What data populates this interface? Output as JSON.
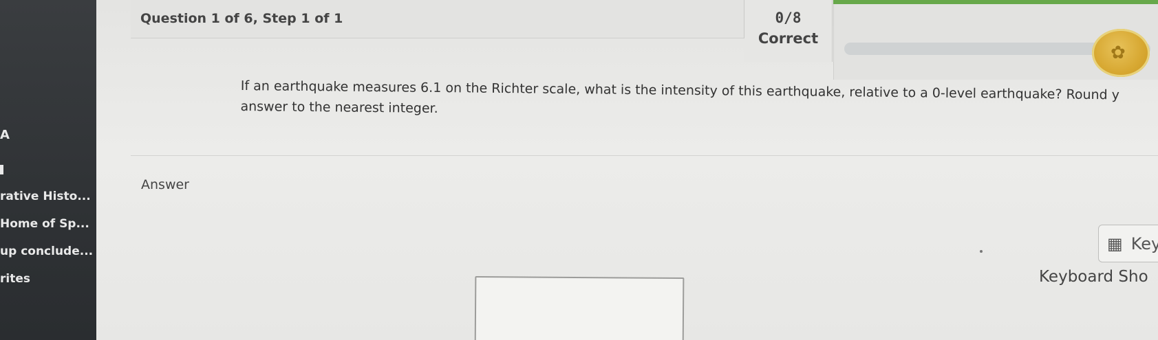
{
  "sidebar": {
    "items": [
      {
        "label": "A"
      },
      {
        "label": "rative Histo..."
      },
      {
        "label": "Home of Sp..."
      },
      {
        "label": "up conclude..."
      },
      {
        "label": "rites"
      }
    ]
  },
  "header": {
    "question_title": "Question 1 of 6, Step 1 of 1",
    "score": "0/8",
    "score_caption": "Correct",
    "progress_fraction": 0
  },
  "question": {
    "text": "If an earthquake measures 6.1 on the Richter scale, what is the intensity of this earthquake, relative to a 0-level earthquake? Round y answer to the nearest integer."
  },
  "answer": {
    "label": "Answer",
    "value": ""
  },
  "tools": {
    "keypad_label": "Key",
    "keypad_icon": "calculator-icon",
    "shortcuts_label": "Keyboard Sho"
  },
  "colors": {
    "sidebar_bg": "#2f3235",
    "accent_green": "#67a84a",
    "coin_gold": "#d8a933"
  }
}
